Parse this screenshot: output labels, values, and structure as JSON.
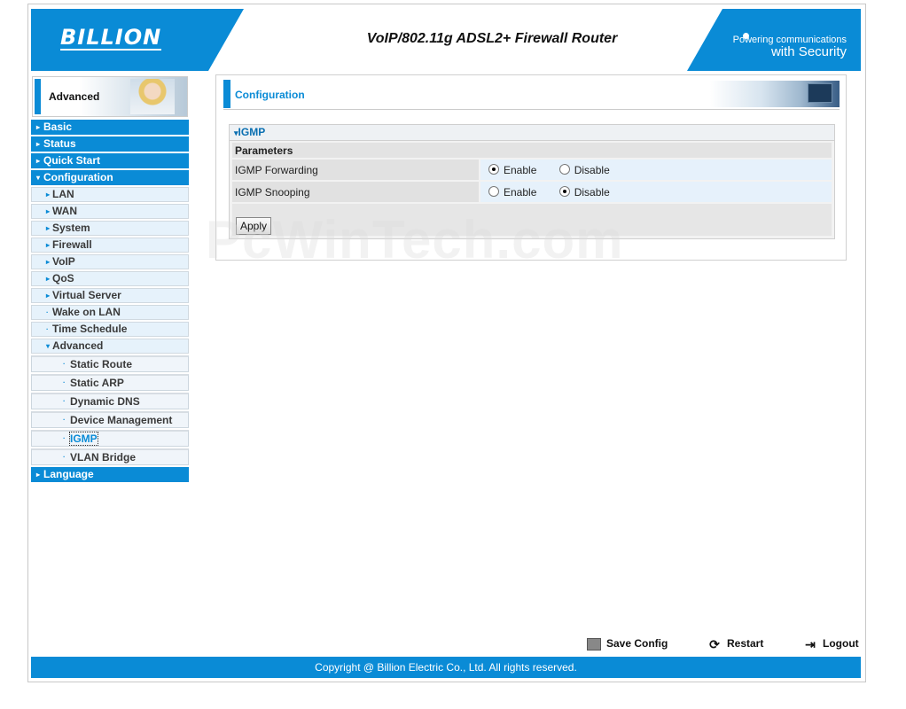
{
  "header": {
    "logo": "BILLION",
    "title": "VoIP/802.11g ADSL2+ Firewall Router",
    "tagline_line1": "Powering communications",
    "tagline_line2": "with Security"
  },
  "sidebar": {
    "section_label": "Advanced",
    "items": [
      {
        "label": "Basic"
      },
      {
        "label": "Status"
      },
      {
        "label": "Quick Start"
      },
      {
        "label": "Configuration"
      }
    ],
    "config_items": [
      {
        "label": "LAN"
      },
      {
        "label": "WAN"
      },
      {
        "label": "System"
      },
      {
        "label": "Firewall"
      },
      {
        "label": "VoIP"
      },
      {
        "label": "QoS"
      },
      {
        "label": "Virtual Server"
      },
      {
        "label": "Wake on LAN"
      },
      {
        "label": "Time Schedule"
      },
      {
        "label": "Advanced"
      }
    ],
    "advanced_items": [
      {
        "label": "Static Route"
      },
      {
        "label": "Static ARP"
      },
      {
        "label": "Dynamic DNS"
      },
      {
        "label": "Device Management"
      },
      {
        "label": "IGMP"
      },
      {
        "label": "VLAN Bridge"
      }
    ],
    "language": "Language"
  },
  "main": {
    "heading": "Configuration",
    "panel_title": "IGMP",
    "params_header": "Parameters",
    "rows": [
      {
        "label": "IGMP Forwarding",
        "enable": "Enable",
        "disable": "Disable",
        "selected": "Enable"
      },
      {
        "label": "IGMP Snooping",
        "enable": "Enable",
        "disable": "Disable",
        "selected": "Disable"
      }
    ],
    "apply_label": "Apply"
  },
  "watermark": "PcWinTech.com",
  "actions": {
    "save": "Save Config",
    "restart": "Restart",
    "logout": "Logout"
  },
  "footer": "Copyright @ Billion Electric Co., Ltd. All rights reserved."
}
